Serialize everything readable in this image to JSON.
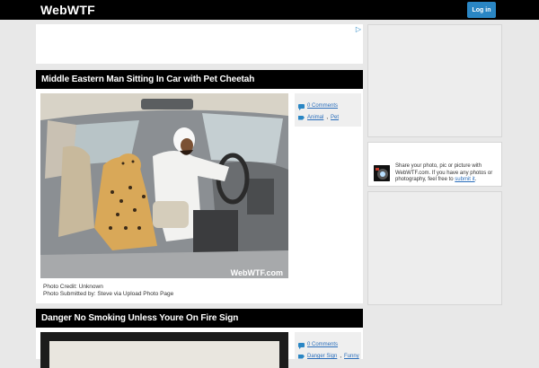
{
  "header": {
    "logo": "WebWTF",
    "login_label": "Log in"
  },
  "ad": {
    "choices_glyph": "▷"
  },
  "posts": [
    {
      "title": "Middle Eastern Man Sitting In Car with Pet Cheetah",
      "comments": "0 Comments",
      "tags": [
        "Animal",
        "Pet"
      ],
      "photo_watermark": "WebWTF.com",
      "credit_line": "Photo Credit: Unknown",
      "submitted_line": "Photo Submitted by: Steve via Upload Photo Page"
    },
    {
      "title": "Danger No Smoking Unless Youre On Fire Sign",
      "comments": "0 Comments",
      "tags": [
        "Danger Sign",
        "Funny"
      ]
    }
  ],
  "sidebar": {
    "share_text": "Share your photo, pic or picture with WebWTF.com. If you have any photos or photography, feel free to ",
    "share_link": "submit it",
    "share_end": "."
  },
  "colors": {
    "accent": "#2a86c4",
    "header": "#000000",
    "background": "#e8e8e8"
  }
}
